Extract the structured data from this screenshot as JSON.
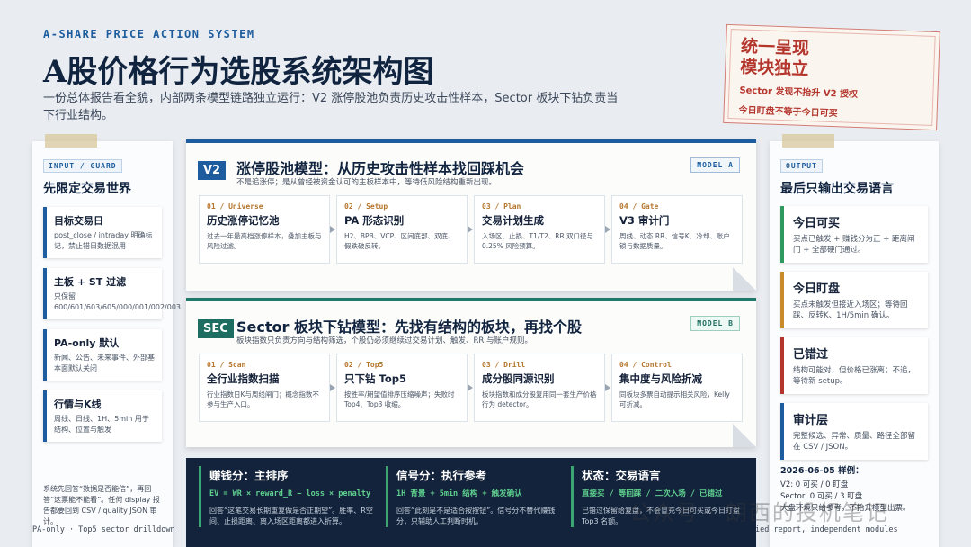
{
  "header": {
    "kicker": "A-SHARE PRICE ACTION SYSTEM",
    "title": "A股价格行为选股系统架构图",
    "subtitle": "一份总体报告看全貌，内部两条模型链路独立运行：V2 涨停股池负责历史攻击性样本，Sector 板块下钻负责当下行业结构。"
  },
  "stamp": {
    "line1": "统一呈现",
    "line2": "模块独立",
    "note1": "Sector 发现不抬升 V2 授权",
    "note2": "今日盯盘不等于今日可买"
  },
  "left": {
    "tag": "INPUT / GUARD",
    "title": "先限定交易世界",
    "cards": [
      {
        "h": "目标交易日",
        "d": "post_close / intraday 明确标记，禁止错日数据混用"
      },
      {
        "h": "主板 + ST 过滤",
        "d": "只保留 600/601/603/605/000/001/002/003"
      },
      {
        "h": "PA-only 默认",
        "d": "新闻、公告、未来事件、外部基本面默认关闭"
      },
      {
        "h": "行情与K线",
        "d": "周线、日线、1H、5min 用于结构、位置与触发"
      }
    ],
    "footer": "系统先回答“数据是否能信”，再回答“这票能不能看”。任何 display 报告都要回到 CSV / quality JSON 审计。"
  },
  "modelA": {
    "badge": "V2",
    "title": "涨停股池模型：从历史攻击性样本找回踩机会",
    "sub": "不是追涨停；是从曾经被资金认可的主板样本中，等待低风险结构重新出现。",
    "tag": "MODEL A",
    "steps": [
      {
        "n": "01 / Universe",
        "h": "历史涨停记忆池",
        "d": "过去一年最高档涨停样本，叠加主板与风险过滤。"
      },
      {
        "n": "02 / Setup",
        "h": "PA 形态识别",
        "d": "H2、BPB、VCP、区间底部、双底、假跌破反转。"
      },
      {
        "n": "03 / Plan",
        "h": "交易计划生成",
        "d": "入场区、止损、T1/T2、RR 双口径与 0.25% 风险预算。"
      },
      {
        "n": "04 / Gate",
        "h": "V3 审计门",
        "d": "周线、动态 RR、信号K、冷却、账户锁与数据质量。"
      }
    ]
  },
  "modelB": {
    "badge": "SEC",
    "title": "Sector 板块下钻模型：先找有结构的板块，再找个股",
    "sub": "板块指数只负责方向与结构筛选，个股仍必须继续过交易计划、触发、RR 与账户规则。",
    "tag": "MODEL B",
    "steps": [
      {
        "n": "01 / Scan",
        "h": "全行业指数扫描",
        "d": "行业指数日K与周线闸门；概念指数不参与生产入口。"
      },
      {
        "n": "02 / Top5",
        "h": "只下钻 Top5",
        "d": "按胜率/期望值排序压缩噪声；失败时 Top4、Top3 收缩。"
      },
      {
        "n": "03 / Drill",
        "h": "成分股同源识别",
        "d": "板块指数和成分股复用同一套生产价格行为 detector。"
      },
      {
        "n": "04 / Control",
        "h": "集中度与风险折减",
        "d": "同板块多票自动提示相关风险，Kelly 可折减。"
      }
    ]
  },
  "bottom": [
    {
      "h": "赚钱分：主排序",
      "f": "EV = WR × reward_R − loss × penalty",
      "d": "回答“这笔交易长期重复做是否正期望”。胜率、R空间、止损距离、离入场区距离都进入折算。"
    },
    {
      "h": "信号分：执行参考",
      "f": "1H 背景 + 5min 结构 + 触发确认",
      "d": "回答“此刻是不是适合按按钮”。信号分不替代赚钱分，只辅助人工判断时机。"
    },
    {
      "h": "状态：交易语言",
      "f": "直接买 / 等回踩 / 二次入场 / 已错过",
      "d": "已错过保留给复盘，不会冒充今日可买或今日盯盘 Top3 名额。"
    }
  ],
  "right": {
    "tag": "OUTPUT",
    "title": "最后只输出交易语言",
    "cards": [
      {
        "h": "今日可买",
        "d": "买点已触发 + 赚钱分为正 + 距离闸门 + 全部硬门通过。",
        "c": "#2e9a5f"
      },
      {
        "h": "今日盯盘",
        "d": "买点未触发但接近入场区；等待回踩、反转K、1H/5min 确认。",
        "c": "#c98a2c"
      },
      {
        "h": "已错过",
        "d": "结构可能对，但价格已涨离；不追，等待新 setup。",
        "c": "#b4352c"
      },
      {
        "h": "审计层",
        "d": "完整候选、异常、质量、路径全部留在 CSV / JSON。",
        "c": "#1d5d9f"
      }
    ],
    "sample_title": "2026-06-05 样例：",
    "sample": [
      "V2: 0 可买 / 0 盯盘",
      "Sector: 0 可买 / 3 盯盘",
      "大盘环境只给参考，不抬升模型出票。"
    ]
  },
  "footer": {
    "left": "PA-only · Top5 sector drilldown",
    "right": "ied report, independent modules",
    "watermark": "公众号 · 朗西的投机笔记"
  }
}
